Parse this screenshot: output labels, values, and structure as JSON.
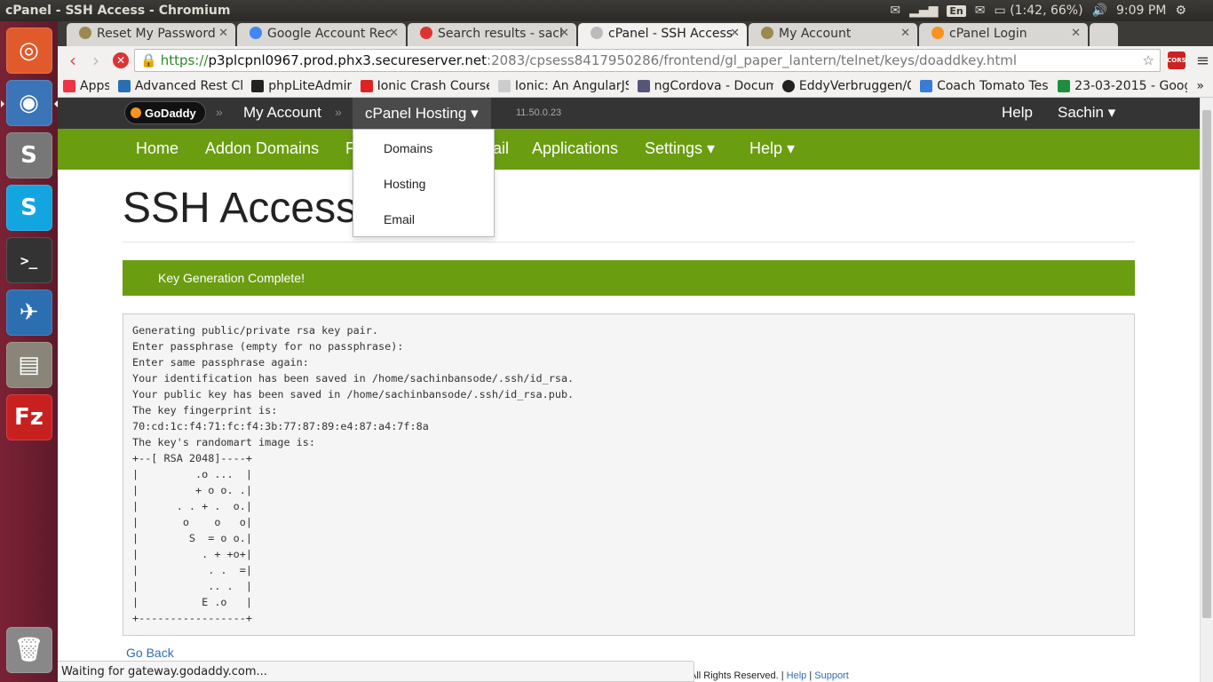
{
  "os": {
    "window_title": "cPanel - SSH Access - Chromium",
    "tray": {
      "lang": "En",
      "battery": "(1:42, 66%)",
      "clock": "9:09 PM"
    },
    "launcher": [
      "ubuntu-home",
      "chromium",
      "sublime-text",
      "skype",
      "terminal",
      "thunderbird",
      "files",
      "filezilla",
      "trash"
    ],
    "launcher_glyphs": {
      "sublime": "S",
      "skype": "S",
      "filezilla": "Fz",
      "terminal": ">_"
    }
  },
  "browser": {
    "tabs": [
      {
        "label": "Reset My Password",
        "color": "#9a8a50"
      },
      {
        "label": "Google Account Reco",
        "color": "#4285f4"
      },
      {
        "label": "Search results - sachin",
        "color": "#d33"
      },
      {
        "label": "cPanel - SSH Access",
        "color": "#bbb"
      },
      {
        "label": "My Account",
        "color": "#9a8a50"
      },
      {
        "label": "cPanel Login",
        "color": "#f7941d"
      }
    ],
    "url": {
      "scheme": "https://",
      "host": "p3plcpnl0967.prod.phx3.secureserver.net",
      "path": ":2083/cpsess8417950286/frontend/gl_paper_lantern/telnet/keys/doaddkey.html"
    },
    "ext_badge": "CORS",
    "bookmarks": [
      {
        "label": "Apps",
        "color": "#e34"
      },
      {
        "label": "Advanced Rest Cli",
        "color": "#2a6fb4"
      },
      {
        "label": "phpLiteAdmin",
        "color": "#222"
      },
      {
        "label": "Ionic Crash Course",
        "color": "#d22"
      },
      {
        "label": "Ionic: An AngularJS",
        "color": "#ccc"
      },
      {
        "label": "ngCordova - Docum",
        "color": "#557"
      },
      {
        "label": "EddyVerbruggen/C",
        "color": "#222"
      },
      {
        "label": "Coach Tomato Test",
        "color": "#3a7bd5"
      },
      {
        "label": "23-03-2015 - Goog",
        "color": "#1e8e3e"
      }
    ],
    "bookmarks_more": "»",
    "status": "Waiting for gateway.godaddy.com..."
  },
  "cpanel": {
    "logo": "GoDaddy",
    "crumb_sep": "»",
    "crumbs": {
      "my_account": "My Account",
      "cpanel_hosting": "cPanel Hosting ▾"
    },
    "version": "11.50.0.23",
    "help": "Help",
    "user": "Sachin ▾",
    "nav": {
      "home": "Home",
      "addon": "Addon Domains",
      "f": "F",
      "ail": "ail",
      "applications": "Applications",
      "settings": "Settings ▾",
      "help": "Help ▾"
    },
    "dropdown": [
      "Domains",
      "Hosting",
      "Email"
    ],
    "title": "SSH Access",
    "alert": "Key Generation Complete!",
    "output": [
      "Generating public/private rsa key pair.",
      "Enter passphrase (empty for no passphrase):",
      "Enter same passphrase again:",
      "Your identification has been saved in /home/sachinbansode/.ssh/id_rsa.",
      "Your public key has been saved in /home/sachinbansode/.ssh/id_rsa.pub.",
      "The key fingerprint is:",
      "70:cd:1c:f4:71:fc:f4:3b:77:87:89:e4:87:a4:7f:8a",
      "The key's randomart image is:",
      "+--[ RSA 2048]----+",
      "|         .o ...  |",
      "|         + o o. .|",
      "|      . . + .  o.|",
      "|       o    o   o|",
      "|        S  = o o.|",
      "|          . + +o+|",
      "|           . .  =|",
      "|           .. .  |",
      "|          E .o   |",
      "+-----------------+"
    ],
    "go_back": "Go Back",
    "footer": {
      "text": "All Rights Reserved. |",
      "help": "Help",
      "sep": "|",
      "support": "Support"
    }
  }
}
